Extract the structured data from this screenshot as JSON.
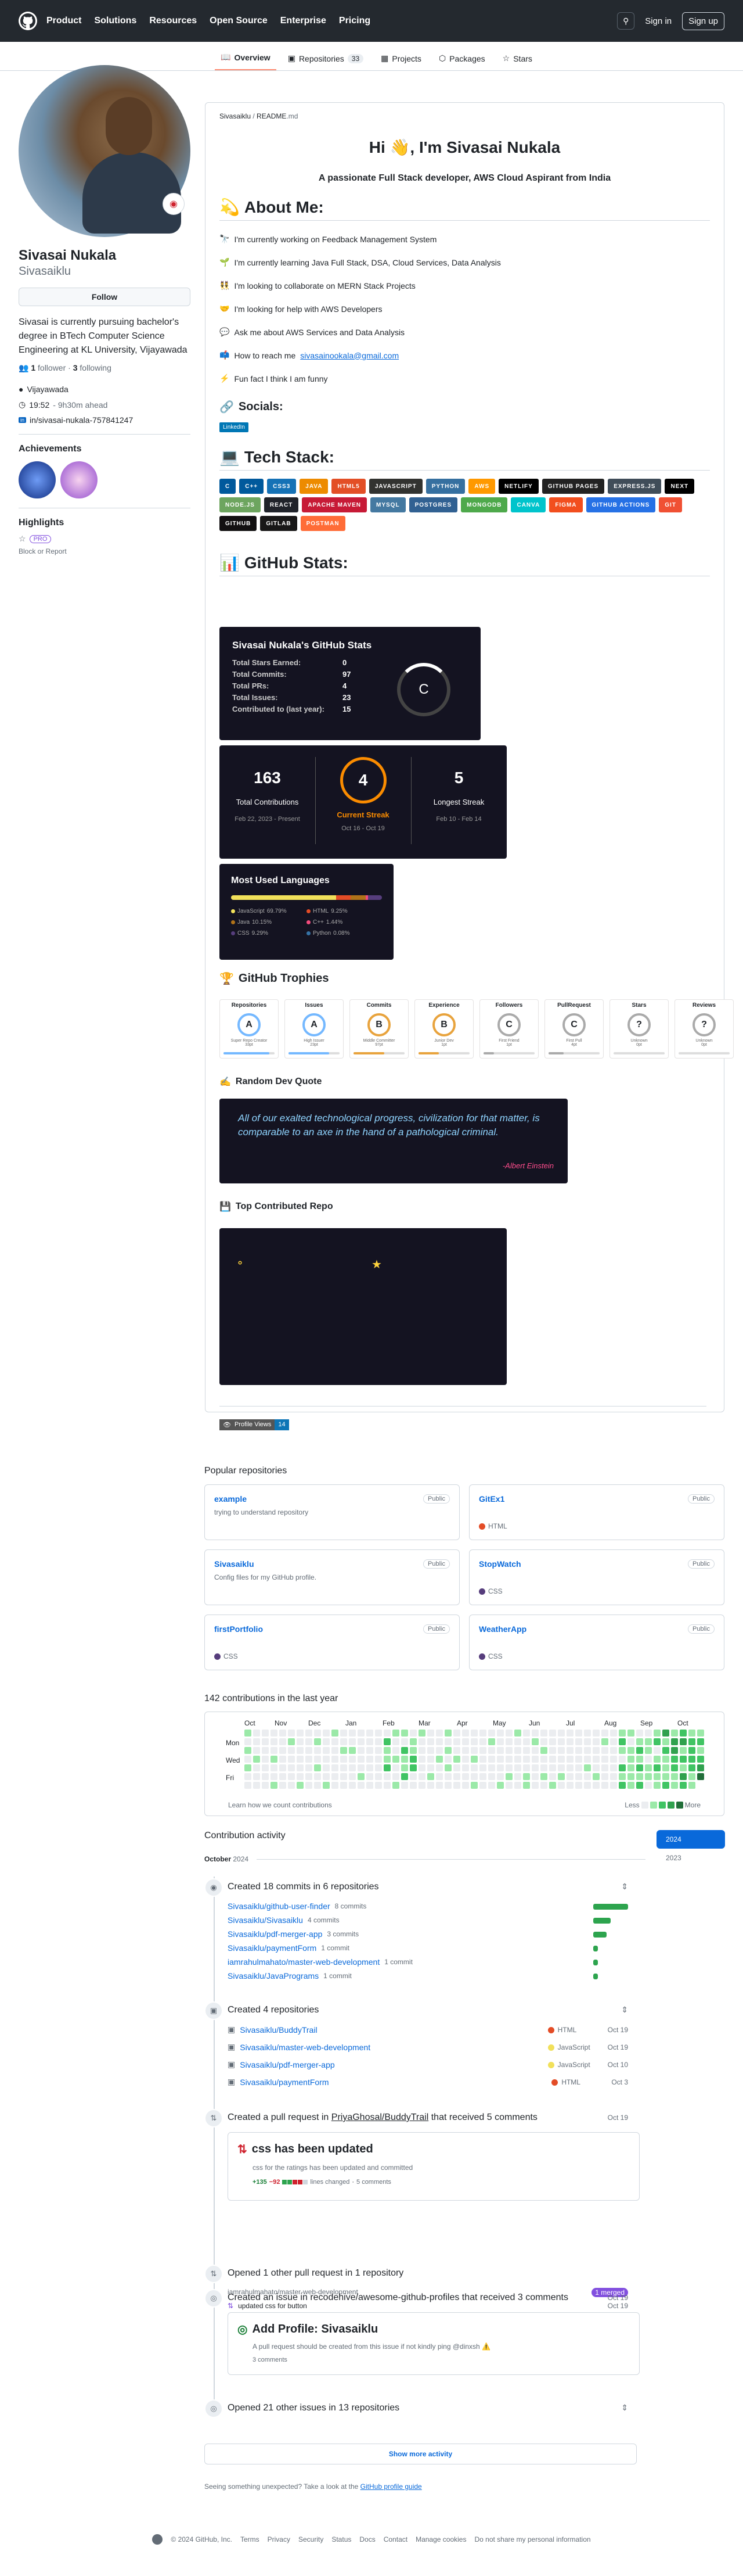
{
  "header": {
    "nav": [
      "Product",
      "Solutions",
      "Resources",
      "Open Source",
      "Enterprise",
      "Pricing"
    ],
    "sign_in": "Sign in",
    "sign_up": "Sign up"
  },
  "tabs": [
    {
      "label": "Overview",
      "icon": "book-icon"
    },
    {
      "label": "Repositories",
      "icon": "repo-icon",
      "count": "33"
    },
    {
      "label": "Projects",
      "icon": "table-icon"
    },
    {
      "label": "Packages",
      "icon": "package-icon"
    },
    {
      "label": "Stars",
      "icon": "star-icon"
    }
  ],
  "profile": {
    "name": "Sivasai Nukala",
    "username": "Sivasaiklu",
    "follow": "Follow",
    "bio": "Sivasai is currently pursuing bachelor's degree in BTech Computer Science Engineering at KL University, Vijayawada",
    "followers_count": "1",
    "followers_label": "follower",
    "following_count": "3",
    "following_label": "following",
    "location": "Vijayawada",
    "time": "19:52",
    "time_note": "- 9h30m ahead",
    "linkedin": "in/sivasai-nukala-757841247",
    "achievements_title": "Achievements",
    "highlights_title": "Highlights",
    "pro": "PRO",
    "block": "Block or Report"
  },
  "readme": {
    "path_user": "Sivasaiklu",
    "path_sep": " / ",
    "path_file": "README",
    "path_ext": ".md",
    "title": "Hi 👋, I'm Sivasai Nukala",
    "subtitle": "A passionate Full Stack developer, AWS Cloud Aspirant from India",
    "about_title": "About Me:",
    "about": [
      {
        "emoji": "🔭",
        "text": "I'm currently working on Feedback Management System"
      },
      {
        "emoji": "🌱",
        "text": "I'm currently learning Java Full Stack, DSA, Cloud Services, Data Analysis"
      },
      {
        "emoji": "👯",
        "text": "I'm looking to collaborate on MERN Stack Projects"
      },
      {
        "emoji": "🤝",
        "text": "I'm looking for help with AWS Developers"
      },
      {
        "emoji": "💬",
        "text": "Ask me about AWS Services and Data Analysis"
      },
      {
        "emoji": "📫",
        "text": "How to reach me",
        "link": "sivasainookala@gmail.com"
      },
      {
        "emoji": "⚡",
        "text": "Fun fact I think I am funny"
      }
    ],
    "socials_title": "Socials:",
    "linkedin_badge": "LinkedIn",
    "tech_title": "Tech Stack:",
    "tech": [
      {
        "label": "C",
        "color": "#00599C"
      },
      {
        "label": "C++",
        "color": "#00599C"
      },
      {
        "label": "CSS3",
        "color": "#1572B6"
      },
      {
        "label": "JAVA",
        "color": "#ED8B00"
      },
      {
        "label": "HTML5",
        "color": "#E34F26"
      },
      {
        "label": "JAVASCRIPT",
        "color": "#323330"
      },
      {
        "label": "PYTHON",
        "color": "#3670A0"
      },
      {
        "label": "AWS",
        "color": "#FF9900"
      },
      {
        "label": "NETLIFY",
        "color": "#000000"
      },
      {
        "label": "GITHUB PAGES",
        "color": "#222222"
      },
      {
        "label": "EXPRESS.JS",
        "color": "#404d59"
      },
      {
        "label": "NEXT",
        "color": "#000000"
      },
      {
        "label": "NODE.JS",
        "color": "#6DA55F"
      },
      {
        "label": "REACT",
        "color": "#20232a"
      },
      {
        "label": "APACHE MAVEN",
        "color": "#C71A36"
      },
      {
        "label": "MYSQL",
        "color": "#4479A1"
      },
      {
        "label": "POSTGRES",
        "color": "#316192"
      },
      {
        "label": "MONGODB",
        "color": "#4ea94b"
      },
      {
        "label": "CANVA",
        "color": "#00C4CC"
      },
      {
        "label": "FIGMA",
        "color": "#F24E1E"
      },
      {
        "label": "GITHUB ACTIONS",
        "color": "#2671E5"
      },
      {
        "label": "GIT",
        "color": "#F05033"
      },
      {
        "label": "GITHUB",
        "color": "#121011"
      },
      {
        "label": "GITLAB",
        "color": "#181717"
      },
      {
        "label": "POSTMAN",
        "color": "#FF6C37"
      }
    ],
    "stats_title": "GitHub Stats:",
    "stats_card": {
      "title": "Sivasai Nukala's GitHub Stats",
      "rows": [
        {
          "label": "Total Stars Earned:",
          "value": "0"
        },
        {
          "label": "Total Commits:",
          "value": "97"
        },
        {
          "label": "Total PRs:",
          "value": "4"
        },
        {
          "label": "Total Issues:",
          "value": "23"
        },
        {
          "label": "Contributed to (last year):",
          "value": "15"
        }
      ],
      "grade": "C"
    },
    "streak": {
      "total": "163",
      "total_label": "Total Contributions",
      "total_range": "Feb 22, 2023 - Present",
      "current": "4",
      "current_label": "Current Streak",
      "current_range": "Oct 16 - Oct 19",
      "longest": "5",
      "longest_label": "Longest Streak",
      "longest_range": "Feb 10 - Feb 14"
    },
    "langs": {
      "title": "Most Used Languages",
      "items": [
        {
          "name": "JavaScript",
          "pct": "69.79%",
          "color": "#f1e05a"
        },
        {
          "name": "HTML",
          "pct": "9.25%",
          "color": "#e34c26"
        },
        {
          "name": "Java",
          "pct": "10.15%",
          "color": "#b07219"
        },
        {
          "name": "C++",
          "pct": "1.44%",
          "color": "#f34b7d"
        },
        {
          "name": "CSS",
          "pct": "9.29%",
          "color": "#563d7c"
        },
        {
          "name": "Python",
          "pct": "0.08%",
          "color": "#3572A5"
        }
      ]
    },
    "trophies_title": "GitHub Trophies",
    "trophies": [
      {
        "name": "Repositories",
        "rank": "A",
        "sub": "Super Repo Creator",
        "val": "33pt",
        "color": "#74b8ff",
        "fill": 0.9
      },
      {
        "name": "Issues",
        "rank": "A",
        "sub": "High Issuer",
        "val": "23pt",
        "color": "#74b8ff",
        "fill": 0.8
      },
      {
        "name": "Commits",
        "rank": "B",
        "sub": "Middle Committer",
        "val": "97pt",
        "color": "#e8a33d",
        "fill": 0.6
      },
      {
        "name": "Experience",
        "rank": "B",
        "sub": "Junior Dev",
        "val": "1pt",
        "color": "#e8a33d",
        "fill": 0.4
      },
      {
        "name": "Followers",
        "rank": "C",
        "sub": "First Friend",
        "val": "1pt",
        "color": "#aaaaaa",
        "fill": 0.2
      },
      {
        "name": "PullRequest",
        "rank": "C",
        "sub": "First Pull",
        "val": "4pt",
        "color": "#aaaaaa",
        "fill": 0.3
      },
      {
        "name": "Stars",
        "rank": "?",
        "sub": "Unknown",
        "val": "0pt",
        "color": "#aaaaaa",
        "fill": 0.0
      },
      {
        "name": "Reviews",
        "rank": "?",
        "sub": "Unknown",
        "val": "0pt",
        "color": "#aaaaaa",
        "fill": 0.0
      }
    ],
    "quote_title": "Random Dev Quote",
    "quote": "All of our exalted technological progress, civilization for that matter, is comparable to an axe in the hand of a pathological criminal.",
    "quote_author": "-Albert Einstein",
    "top_repo_title": "Top Contributed Repo",
    "profile_views_label": "Profile Views",
    "profile_views": "14"
  },
  "popular": {
    "title": "Popular repositories",
    "public": "Public",
    "repos": [
      {
        "name": "example",
        "desc": "trying to understand repository",
        "lang": "",
        "lang_color": ""
      },
      {
        "name": "GitEx1",
        "desc": "",
        "lang": "HTML",
        "lang_color": "#e34c26"
      },
      {
        "name": "Sivasaiklu",
        "desc": "Config files for my GitHub profile.",
        "lang": "",
        "lang_color": ""
      },
      {
        "name": "StopWatch",
        "desc": "",
        "lang": "CSS",
        "lang_color": "#563d7c"
      },
      {
        "name": "firstPortfolio",
        "desc": "",
        "lang": "CSS",
        "lang_color": "#563d7c"
      },
      {
        "name": "WeatherApp",
        "desc": "",
        "lang": "CSS",
        "lang_color": "#563d7c"
      }
    ]
  },
  "contrib": {
    "title": "142 contributions in the last year",
    "months": [
      "Oct",
      "Nov",
      "Dec",
      "Jan",
      "Feb",
      "Mar",
      "Apr",
      "May",
      "Jun",
      "Jul",
      "Aug",
      "Sep",
      "Oct"
    ],
    "days": [
      "Mon",
      "Wed",
      "Fri"
    ],
    "learn": "Learn how we count contributions",
    "less": "Less",
    "more": "More",
    "levels": [
      "#ebedf0",
      "#9be9a8",
      "#40c463",
      "#30a14e",
      "#216e39"
    ]
  },
  "activity": {
    "title": "Contribution activity",
    "month": "October",
    "year": "2024",
    "years": [
      "2024",
      "2023"
    ],
    "commits": {
      "title": "Created 18 commits in 6 repositories",
      "items": [
        {
          "repo": "Sivasaiklu/github-user-finder",
          "count": "8 commits",
          "w": 1.0
        },
        {
          "repo": "Sivasaiklu/Sivasaiklu",
          "count": "4 commits",
          "w": 0.5
        },
        {
          "repo": "Sivasaiklu/pdf-merger-app",
          "count": "3 commits",
          "w": 0.38
        },
        {
          "repo": "Sivasaiklu/paymentForm",
          "count": "1 commit",
          "w": 0.13
        },
        {
          "repo": "iamrahulmahato/master-web-development",
          "count": "1 commit",
          "w": 0.13
        },
        {
          "repo": "Sivasaiklu/JavaPrograms",
          "count": "1 commit",
          "w": 0.13
        }
      ]
    },
    "repos": {
      "title": "Created 4 repositories",
      "items": [
        {
          "repo": "Sivasaiklu/BuddyTrail",
          "lang": "HTML",
          "color": "#e34c26",
          "date": "Oct 19"
        },
        {
          "repo": "Sivasaiklu/master-web-development",
          "lang": "JavaScript",
          "color": "#f1e05a",
          "date": "Oct 19"
        },
        {
          "repo": "Sivasaiklu/pdf-merger-app",
          "lang": "JavaScript",
          "color": "#f1e05a",
          "date": "Oct 10"
        },
        {
          "repo": "Sivasaiklu/paymentForm",
          "lang": "HTML",
          "color": "#e34c26",
          "date": "Oct 3"
        }
      ]
    },
    "pr": {
      "prefix": "Created a pull request in",
      "repo": "PriyaGhosal/BuddyTrail",
      "suffix": "that received 5 comments",
      "date": "Oct 19",
      "title": "css has been updated",
      "desc": "css for the ratings has been updated and committed",
      "adds": "+135",
      "dels": "−92",
      "lines": "lines changed",
      "comments": "5 comments"
    },
    "opened_pr": {
      "title": "Opened 1 other pull request in 1 repository",
      "repo": "iamrahulmahato/master-web-development",
      "badge": "1 merged",
      "item": "updated css for button",
      "date": "Oct 19"
    },
    "issue": {
      "prefix": "Created an issue in",
      "repo": "recodehive/awesome-github-profiles",
      "suffix": "that received 3 comments",
      "date": "Oct 19",
      "title": "Add Profile: Sivasaiklu",
      "desc": "A pull request should be created from this issue if not kindly ping @dinxsh ⚠️",
      "comments": "3 comments"
    },
    "other_issues": "Opened 21 other issues in 13 repositories",
    "show_more": "Show more activity",
    "unexpected": "Seeing something unexpected? Take a look at the",
    "guide": "GitHub profile guide"
  },
  "footer": {
    "copy": "© 2024 GitHub, Inc.",
    "links": [
      "Terms",
      "Privacy",
      "Security",
      "Status",
      "Docs",
      "Contact",
      "Manage cookies",
      "Do not share my personal information"
    ]
  }
}
